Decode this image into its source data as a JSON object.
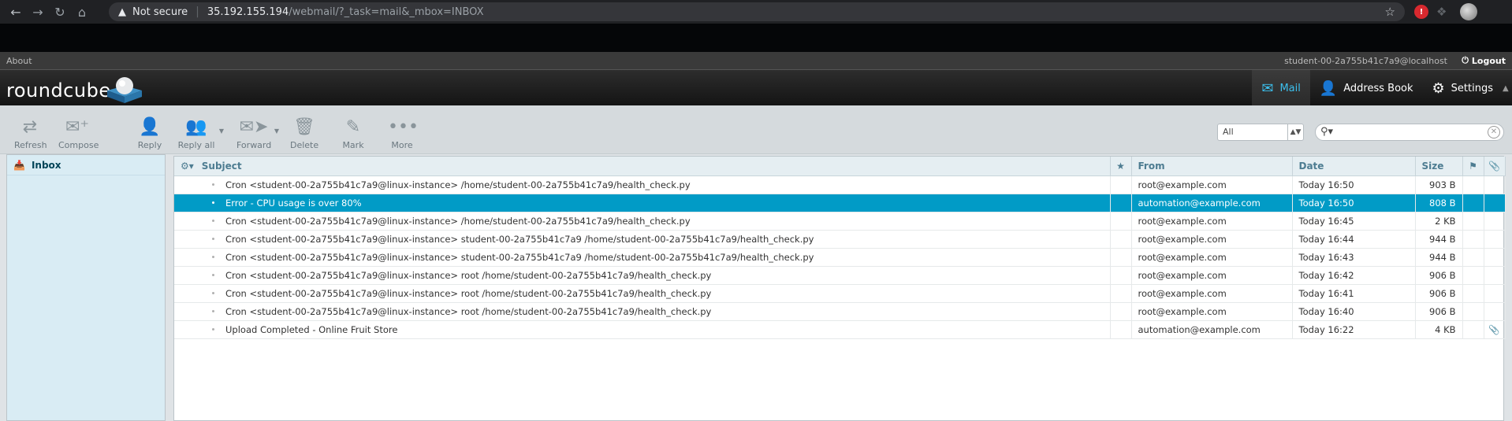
{
  "browser": {
    "warning": "Not secure",
    "url_host": "35.192.155.194",
    "url_path": "/webmail/?_task=mail&_mbox=INBOX"
  },
  "topline": {
    "about": "About",
    "user": "student-00-2a755b41c7a9@localhost",
    "logout": "Logout"
  },
  "header": {
    "logo": "roundcube",
    "tasks": [
      {
        "label": "Mail",
        "icon": "mail-icon"
      },
      {
        "label": "Address Book",
        "icon": "person-icon"
      },
      {
        "label": "Settings",
        "icon": "gear-icon"
      }
    ]
  },
  "toolbar": {
    "refresh": "Refresh",
    "compose": "Compose",
    "reply": "Reply",
    "reply_all": "Reply all",
    "forward": "Forward",
    "delete": "Delete",
    "mark": "Mark",
    "more": "More"
  },
  "filter": {
    "selected": "All"
  },
  "folders": {
    "inbox": "Inbox"
  },
  "list": {
    "columns": {
      "subject": "Subject",
      "from": "From",
      "date": "Date",
      "size": "Size"
    },
    "messages": [
      {
        "subject": "Cron <student-00-2a755b41c7a9@linux-instance> /home/student-00-2a755b41c7a9/health_check.py",
        "from": "root@example.com",
        "date": "Today 16:50",
        "size": "903 B"
      },
      {
        "subject": "Error - CPU usage is over 80%",
        "from": "automation@example.com",
        "date": "Today 16:50",
        "size": "808 B"
      },
      {
        "subject": "Cron <student-00-2a755b41c7a9@linux-instance> /home/student-00-2a755b41c7a9/health_check.py",
        "from": "root@example.com",
        "date": "Today 16:45",
        "size": "2 KB"
      },
      {
        "subject": "Cron <student-00-2a755b41c7a9@linux-instance> student-00-2a755b41c7a9 /home/student-00-2a755b41c7a9/health_check.py",
        "from": "root@example.com",
        "date": "Today 16:44",
        "size": "944 B"
      },
      {
        "subject": "Cron <student-00-2a755b41c7a9@linux-instance> student-00-2a755b41c7a9 /home/student-00-2a755b41c7a9/health_check.py",
        "from": "root@example.com",
        "date": "Today 16:43",
        "size": "944 B"
      },
      {
        "subject": "Cron <student-00-2a755b41c7a9@linux-instance> root /home/student-00-2a755b41c7a9/health_check.py",
        "from": "root@example.com",
        "date": "Today 16:42",
        "size": "906 B"
      },
      {
        "subject": "Cron <student-00-2a755b41c7a9@linux-instance> root /home/student-00-2a755b41c7a9/health_check.py",
        "from": "root@example.com",
        "date": "Today 16:41",
        "size": "906 B"
      },
      {
        "subject": "Cron <student-00-2a755b41c7a9@linux-instance> root /home/student-00-2a755b41c7a9/health_check.py",
        "from": "root@example.com",
        "date": "Today 16:40",
        "size": "906 B"
      },
      {
        "subject": "Upload Completed - Online Fruit Store",
        "from": "automation@example.com",
        "date": "Today 16:22",
        "size": "4 KB"
      }
    ]
  }
}
